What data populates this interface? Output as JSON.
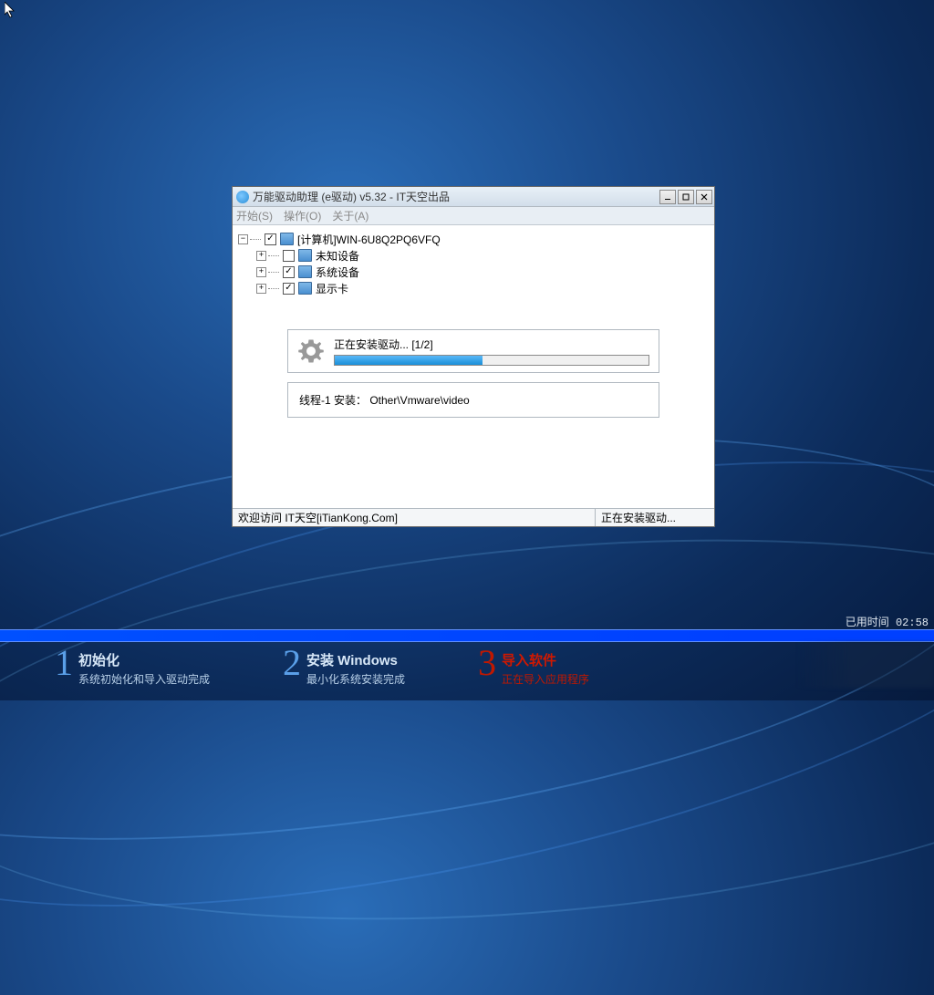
{
  "window": {
    "title": "万能驱动助理 (e驱动) v5.32 - IT天空出品"
  },
  "menu": {
    "start": "开始(S)",
    "operation": "操作(O)",
    "about": "关于(A)"
  },
  "tree": {
    "computer": "[计算机]WIN-6U8Q2PQ6VFQ",
    "unknown": "未知设备",
    "system": "系统设备",
    "display": "显示卡"
  },
  "progress": {
    "label": "正在安装驱动... [1/2]"
  },
  "thread": {
    "text": "线程-1 安装： Other\\Vmware\\video"
  },
  "status": {
    "left": "欢迎访问 IT天空[iTianKong.Com]",
    "right": "正在安装驱动..."
  },
  "timer": {
    "text": "已用时间 02:58"
  },
  "steps": {
    "s1": {
      "num": "1",
      "title": "初始化",
      "sub": "系统初始化和导入驱动完成"
    },
    "s2": {
      "num": "2",
      "title": "安装 Windows",
      "sub": "最小化系统安装完成"
    },
    "s3": {
      "num": "3",
      "title": "导入软件",
      "sub": "正在导入应用程序"
    }
  }
}
